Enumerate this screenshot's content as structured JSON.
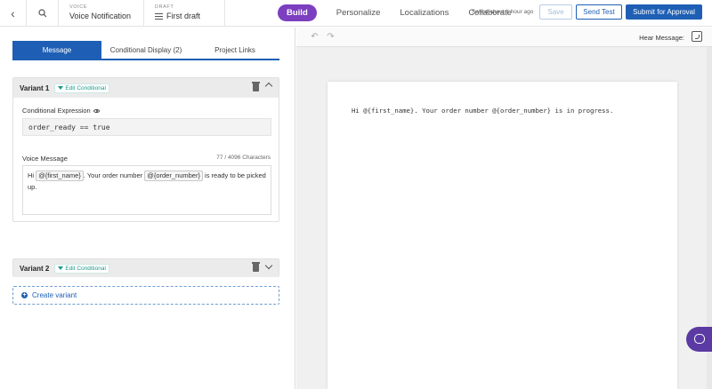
{
  "topbar": {
    "back_icon": "chevron-left-icon",
    "search_icon": "search-icon",
    "type_label": "VOICE",
    "type_value": "Voice Notification",
    "status_label": "DRAFT",
    "status_value": "First draft",
    "nav": [
      "Build",
      "Personalize",
      "Localizations",
      "Collaborate"
    ],
    "saved_text": "Saved about 1 hour ago",
    "save_label": "Save",
    "send_test_label": "Send Test",
    "submit_label": "Submit for Approval",
    "accent_color": "#1e5fb5",
    "brand_color": "#7b3fbf"
  },
  "left": {
    "tabs": [
      "Message",
      "Conditional Display (2)",
      "Project Links"
    ],
    "variant1": {
      "title": "Variant 1",
      "edit_conditional": "Edit Conditional",
      "conditional_label": "Conditional Expression",
      "expression": "order_ready == true",
      "voice_label": "Voice Message",
      "char_count": "77 / 4096 Characters",
      "msg_hi": "Hi",
      "tag_first_name": "@{first_name}",
      "msg_mid": ". Your order number",
      "tag_order_number": "@{order_number}",
      "msg_end": "is ready to be picked up."
    },
    "variant2": {
      "title": "Variant 2",
      "edit_conditional": "Edit Conditional"
    },
    "create_variant": "Create variant"
  },
  "right": {
    "hear_message": "Hear Message:",
    "preview_text": "Hi @{first_name}. Your order number @{order_number} is in progress."
  }
}
